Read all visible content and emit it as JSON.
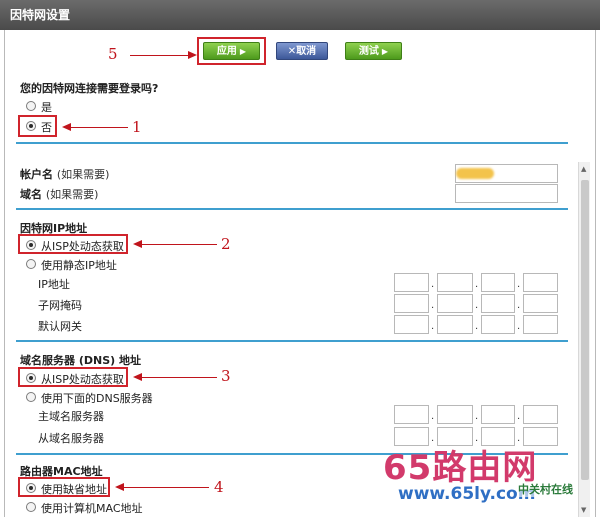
{
  "window": {
    "title": "因特网设置"
  },
  "toolbar": {
    "apply_label": "应用",
    "cancel_label": "取消",
    "test_label": "测试"
  },
  "login": {
    "question": "您的因特网连接需要登录吗?",
    "options": [
      "是",
      "否"
    ],
    "selected": "否"
  },
  "account": {
    "username_label": "帐户名",
    "username_hint": "(如果需要)",
    "domain_label": "域名",
    "domain_hint": "(如果需要)",
    "username_value": "",
    "domain_value": ""
  },
  "ip": {
    "heading": "因特网IP地址",
    "options": [
      "从ISP处动态获取",
      "使用静态IP地址"
    ],
    "selected": "从ISP处动态获取",
    "fields": [
      "IP地址",
      "子网掩码",
      "默认网关"
    ]
  },
  "dns": {
    "heading": "域名服务器 (DNS) 地址",
    "options": [
      "从ISP处动态获取",
      "使用下面的DNS服务器"
    ],
    "selected": "从ISP处动态获取",
    "fields": [
      "主域名服务器",
      "从域名服务器"
    ]
  },
  "mac": {
    "heading": "路由器MAC地址",
    "options": [
      "使用缺省地址",
      "使用计算机MAC地址"
    ],
    "selected": "使用缺省地址"
  },
  "annotations": [
    "1",
    "2",
    "3",
    "4",
    "5"
  ],
  "watermark": {
    "main": "65路由网",
    "url": "www.65ly.com",
    "brand": "中关村在线"
  },
  "colors": {
    "apply_button": "#4d9a1c",
    "cancel_button": "#3d5899",
    "separator": "#3f9fcf",
    "annotation_red": "#c0141c"
  }
}
